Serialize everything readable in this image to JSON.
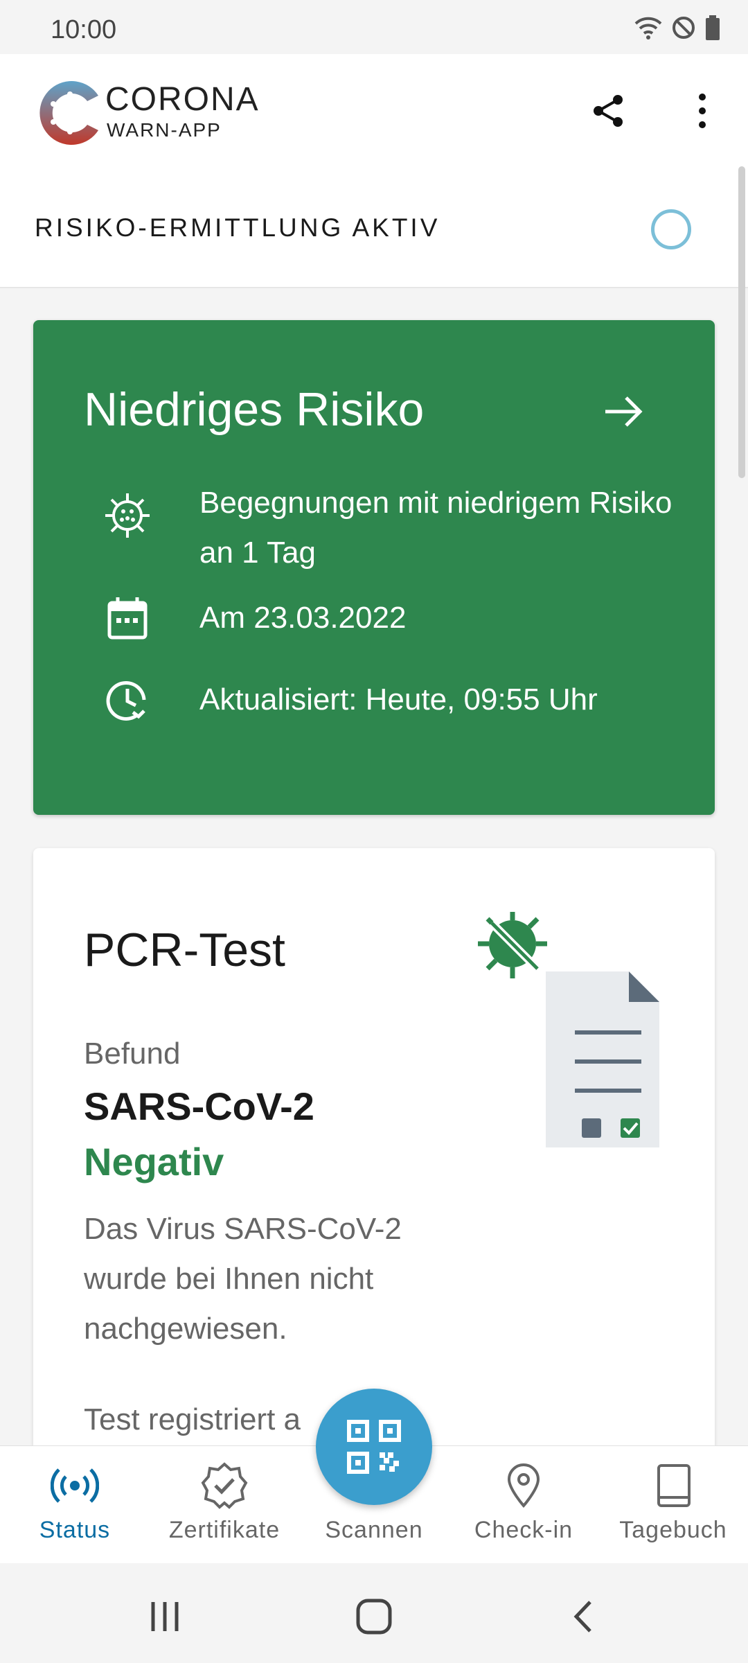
{
  "status_bar": {
    "time": "10:00"
  },
  "app": {
    "brand_line1": "CORONA",
    "brand_line2": "WARN-APP"
  },
  "risk_status": {
    "label": "RISIKO-ERMITTLUNG AKTIV"
  },
  "risk_card": {
    "title": "Niedriges Risiko",
    "encounters": "Begegnungen mit niedrigem Risiko an 1 Tag",
    "date": "Am 23.03.2022",
    "updated": "Aktualisiert: Heute, 09:55 Uhr",
    "color": "#2e874e"
  },
  "test_card": {
    "title": "PCR-Test",
    "befund_label": "Befund",
    "virus": "SARS-CoV-2",
    "result": "Negativ",
    "description": "Das Virus SARS-CoV-2 wurde bei Ihnen nicht nachgewiesen.",
    "registered": "Test registriert a"
  },
  "bottom_nav": {
    "items": [
      {
        "label": "Status",
        "icon": "broadcast-icon",
        "active": true
      },
      {
        "label": "Zertifikate",
        "icon": "certificate-icon"
      },
      {
        "label": "Scannen",
        "icon": "qr-code-icon"
      },
      {
        "label": "Check-in",
        "icon": "location-pin-icon"
      },
      {
        "label": "Tagebuch",
        "icon": "book-icon"
      }
    ]
  },
  "colors": {
    "accent": "#0b6da3",
    "fab": "#3b9ecd",
    "positive_green": "#2e874e"
  }
}
